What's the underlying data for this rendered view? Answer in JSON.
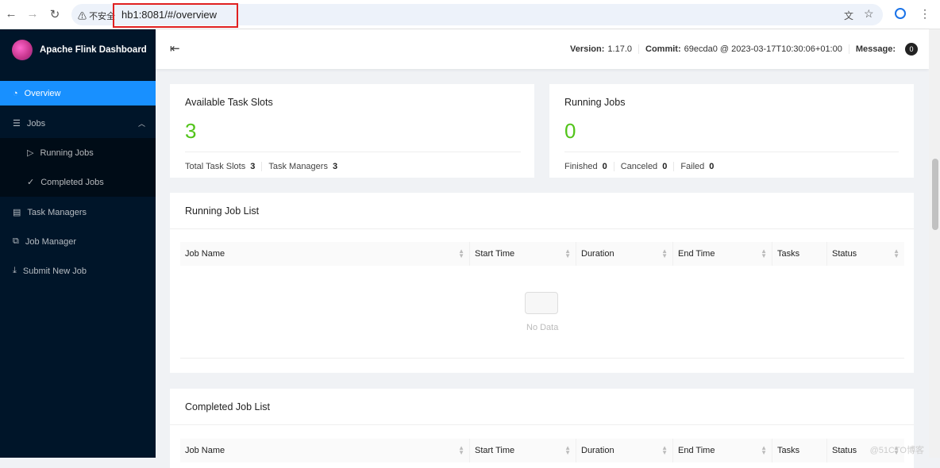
{
  "browser": {
    "insecure_label": "不安全",
    "url": "hb1:8081/#/overview"
  },
  "app": {
    "title": "Apache Flink Dashboard"
  },
  "sidebar": {
    "items": [
      {
        "label": "Overview",
        "icon": "dashboard-icon",
        "active": true
      },
      {
        "label": "Jobs",
        "icon": "list-icon"
      },
      {
        "label": "Running Jobs",
        "icon": "play-circle-icon"
      },
      {
        "label": "Completed Jobs",
        "icon": "check-circle-icon"
      },
      {
        "label": "Task Managers",
        "icon": "schedule-icon"
      },
      {
        "label": "Job Manager",
        "icon": "cluster-icon"
      },
      {
        "label": "Submit New Job",
        "icon": "upload-icon"
      }
    ]
  },
  "header": {
    "version_label": "Version:",
    "version": "1.17.0",
    "commit_label": "Commit:",
    "commit": "69ecda0 @ 2023-03-17T10:30:06+01:00",
    "message_label": "Message:",
    "message_count": "0"
  },
  "slots": {
    "title": "Available Task Slots",
    "value": "3",
    "total_label": "Total Task Slots",
    "total": "3",
    "tm_label": "Task Managers",
    "tm": "3"
  },
  "running": {
    "title": "Running Jobs",
    "value": "0",
    "finished_label": "Finished",
    "finished": "0",
    "canceled_label": "Canceled",
    "canceled": "0",
    "failed_label": "Failed",
    "failed": "0"
  },
  "running_list": {
    "title": "Running Job List",
    "columns": [
      "Job Name",
      "Start Time",
      "Duration",
      "End Time",
      "Tasks",
      "Status"
    ],
    "empty": "No Data"
  },
  "completed_list": {
    "title": "Completed Job List",
    "columns": [
      "Job Name",
      "Start Time",
      "Duration",
      "End Time",
      "Tasks",
      "Status"
    ]
  },
  "watermark": "@51CTO博客",
  "colors": {
    "sidebar": "#001529",
    "active": "#1890ff",
    "big_number": "#52c41a"
  }
}
